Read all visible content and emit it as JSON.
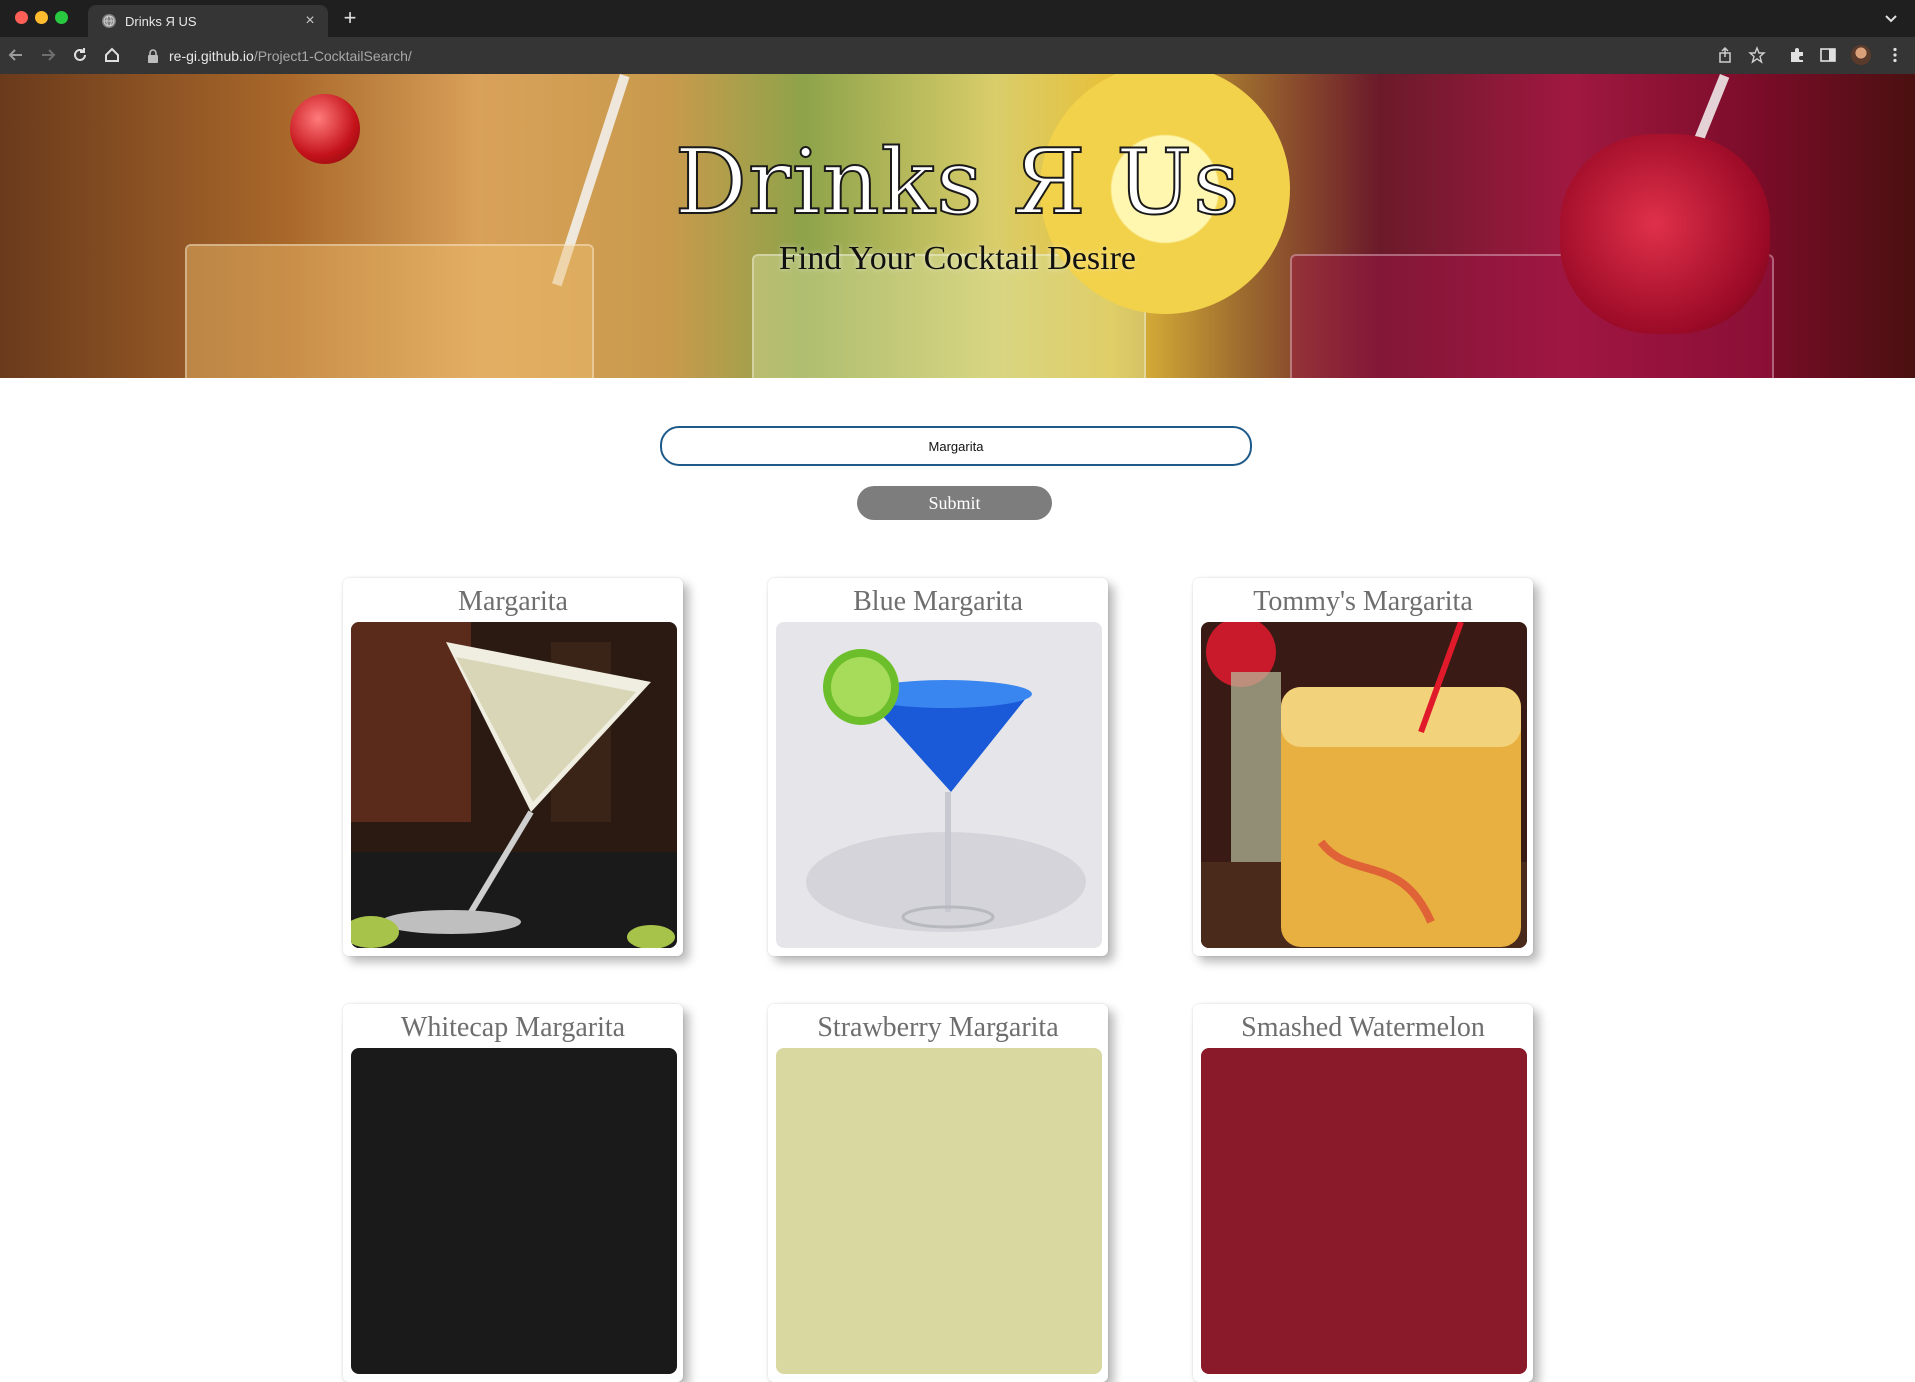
{
  "browser": {
    "tab_title": "Drinks Я US",
    "url_domain": "re-gi.github.io",
    "url_path": "/Project1-CocktailSearch/"
  },
  "hero": {
    "title": "Drinks Я Us",
    "subtitle": "Find Your Cocktail Desire"
  },
  "search": {
    "value": "Margarita",
    "submit_label": "Submit"
  },
  "results": [
    {
      "name": "Margarita"
    },
    {
      "name": "Blue Margarita"
    },
    {
      "name": "Tommy's Margarita"
    },
    {
      "name": "Whitecap Margarita"
    },
    {
      "name": "Strawberry Margarita"
    },
    {
      "name": "Smashed Watermelon"
    }
  ]
}
